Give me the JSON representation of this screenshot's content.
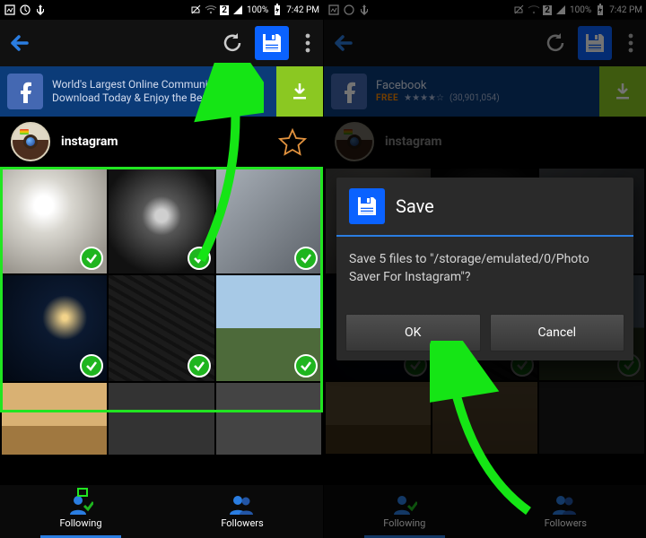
{
  "status": {
    "battery": "100%",
    "time": "7:42 PM",
    "sim": "2"
  },
  "ad_left": {
    "line1": "World's Largest Online Community.",
    "line2": "Download Today & Enjoy the Benefits"
  },
  "ad_right": {
    "title": "Facebook",
    "free": "FREE",
    "stars": "★★★★☆",
    "count": "(30,901,054)"
  },
  "profile": {
    "username": "instagram"
  },
  "tabs": {
    "following": "Following",
    "followers": "Followers"
  },
  "dialog": {
    "title": "Save",
    "body": "Save 5 files to \"/storage/emulated/0/Photo Saver For Instagram\"?",
    "ok": "OK",
    "cancel": "Cancel"
  }
}
